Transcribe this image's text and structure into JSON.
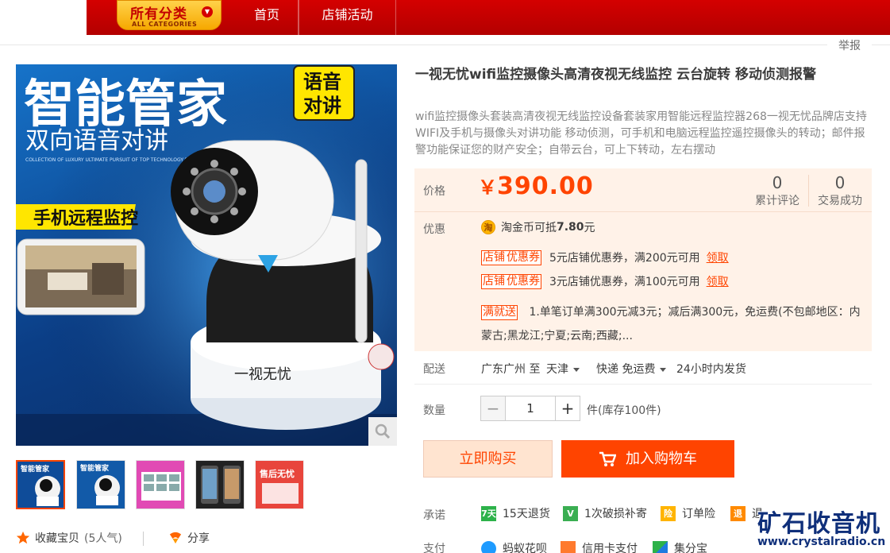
{
  "nav": {
    "categories_label": "所有分类",
    "categories_sub": "ALL CATEGORIES",
    "home": "首页",
    "shop_activity": "店铺活动"
  },
  "report": "举报",
  "product": {
    "title": "一视无忧wifi监控摄像头高清夜视无线监控 云台旋转 移动侦测报警",
    "subtitle": "wifi监控摄像头套装高清夜视无线监控设备套装家用智能远程监控器268一视无忧品牌店支持WIFI及手机与摄像头对讲功能 移动侦测，可手机和电脑远程监控遥控摄像头的转动；邮件报警功能保证您的财产安全；自带云台，可上下转动，左右摆动",
    "image_text": {
      "headline": "智能管家",
      "sub": "双向语音对讲",
      "badge_top": "语音",
      "badge_bottom": "对讲",
      "banner": "手机远程监控",
      "tagline": "COLLECTION OF LUXURY ULTIMATE PURSUIT OF TOP TECHNOLOGY FOR YOU",
      "brand_on_camera": "一视无忧"
    },
    "thumb_last_text": "售后无忧"
  },
  "price": {
    "label": "价格",
    "symbol": "￥",
    "value": "390.00",
    "reviews_count": "0",
    "reviews_label": "累计评论",
    "deals_count": "0",
    "deals_label": "交易成功"
  },
  "promo": {
    "label": "优惠",
    "coin_icon": "淘",
    "coin_text": "淘金币可抵",
    "coin_value": "7.80",
    "coin_unit": "元",
    "coupon_tag_a": "店铺",
    "coupon_tag_b": "优惠券",
    "coupons": [
      {
        "text": "5元店铺优惠券，满200元可用",
        "action": "领取"
      },
      {
        "text": "3元店铺优惠券，满100元可用",
        "action": "领取"
      }
    ],
    "full_tag": "满就送",
    "full_text": "1.单笔订单满300元减3元；减后满300元，免运费(不包邮地区：内蒙古;黑龙江;宁夏;云南;西藏;..."
  },
  "shipping": {
    "label": "配送",
    "from": "广东广州 至",
    "to": "天津",
    "method": "快递 免运费",
    "time": "24小时内发货"
  },
  "quantity": {
    "label": "数量",
    "minus": "−",
    "value": "1",
    "plus": "+",
    "stock": "件(库存100件)"
  },
  "actions": {
    "buy_now": "立即购买",
    "add_cart": "加入购物车"
  },
  "promise": {
    "label": "承诺",
    "items": [
      {
        "icon": "7天",
        "text": "15天退货"
      },
      {
        "icon": "V",
        "text": "1次破损补寄"
      },
      {
        "icon": "险",
        "text": "订单险"
      },
      {
        "icon": "退",
        "text": "退"
      }
    ]
  },
  "payment": {
    "label": "支付",
    "items": [
      "蚂蚁花呗",
      "信用卡支付",
      "集分宝"
    ]
  },
  "favorites": {
    "collect": "收藏宝贝",
    "popularity": "(5人气)",
    "share": "分享"
  },
  "watermark": {
    "cn": "矿石收音机",
    "url": "www.crystalradio.cn"
  },
  "colors": {
    "brand_red": "#c40000",
    "accent_orange": "#ff4400",
    "price_bg": "#fff2e8"
  }
}
